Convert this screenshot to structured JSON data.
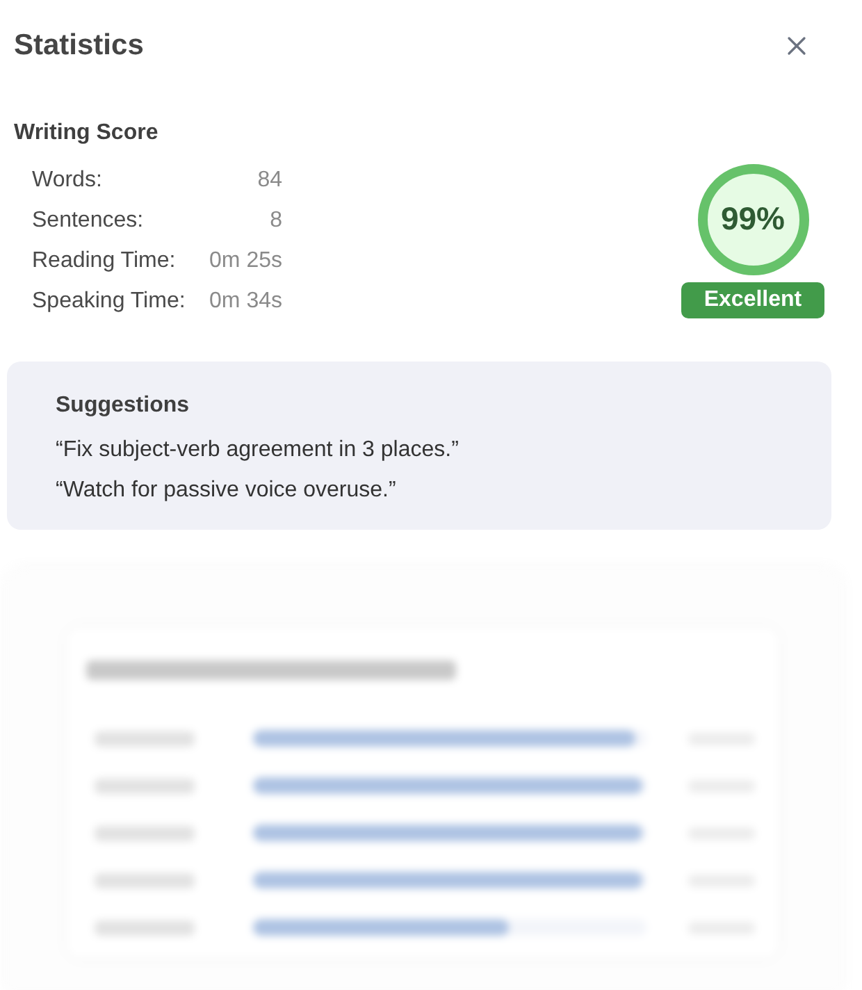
{
  "title": "Statistics",
  "writing_score": {
    "heading": "Writing Score",
    "stats": [
      {
        "label": "Words:",
        "value": "84"
      },
      {
        "label": "Sentences:",
        "value": "8"
      },
      {
        "label": "Reading Time:",
        "value": "0m 25s"
      },
      {
        "label": "Speaking Time:",
        "value": "0m 34s"
      }
    ],
    "score": "99%",
    "rating": "Excellent"
  },
  "suggestions": {
    "heading": "Suggestions",
    "items": [
      "“Fix subject-verb agreement in 3 places.”",
      "“Watch for passive voice overuse.”"
    ]
  },
  "blurred_breakdown": {
    "bars": [
      {
        "level": 0.97
      },
      {
        "level": 0.99
      },
      {
        "level": 0.99
      },
      {
        "level": 0.99
      },
      {
        "level": 0.65
      }
    ]
  }
}
